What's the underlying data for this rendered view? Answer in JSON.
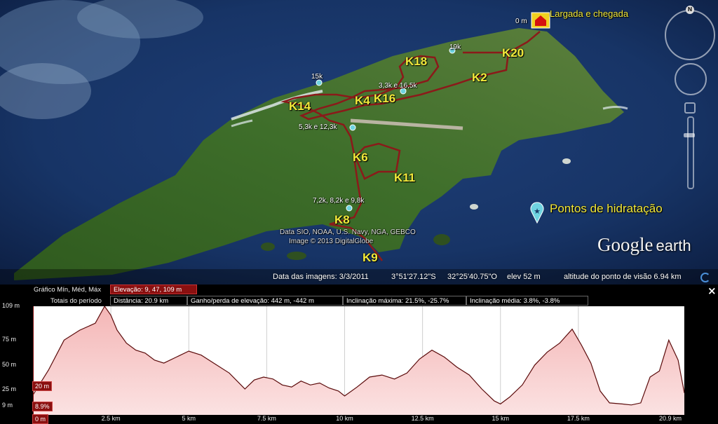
{
  "map": {
    "start_finish_label": "Largada e chegada",
    "start_distance_label": "0 m",
    "hydration_label": "Pontos de hidratação",
    "km_markers": [
      "K18",
      "K20",
      "K2",
      "K4",
      "K16",
      "K14",
      "K6",
      "K11",
      "K8",
      "K9"
    ],
    "hydration_points": [
      "19k",
      "15k",
      "3,3k e 16,5k",
      "5,3k e 12,3k",
      "7,2k, 8,2k e 9,8k"
    ],
    "attribution_line1": "Data SIO, NOAA, U.S. Navy, NGA, GEBCO",
    "attribution_line2": "Image © 2013 DigitalGlobe",
    "brand_google": "Google",
    "brand_earth": "earth",
    "compass_letter": "N",
    "route_color": "#8b1a1a",
    "label_color": "#f2e93a"
  },
  "status_bar": {
    "imagery_date": "Data das imagens: 3/3/2011",
    "latitude": "3°51'27.12\"S",
    "longitude": "32°25'40.75\"O",
    "elevation": "elev   52 m",
    "eye_altitude": "altitude do ponto de visão   6.94 km"
  },
  "panel": {
    "close_label": "×",
    "graph_label": "Gráfico  Mín, Méd, Máx",
    "elevation_stat": "Elevação: 9, 47, 109 m",
    "totals_label": "Totais do período",
    "distance_stat": "Distância: 20.9 km",
    "gain_loss_stat": "Ganho/perda de elevação: 442 m, -442 m",
    "max_slope_stat": "Inclinação máxima: 21.5%, -25.7%",
    "avg_slope_stat": "Inclinação média: 3.8%, -3.8%",
    "cursor_elevation": "20 m",
    "cursor_slope": "8.9%",
    "cursor_distance": "0 m"
  },
  "chart_data": {
    "type": "area",
    "xlabel": "",
    "ylabel": "",
    "x_ticks": [
      "2.5 km",
      "5 km",
      "7.5 km",
      "10 km",
      "12.5 km",
      "15 km",
      "17.5 km",
      "20.9 km"
    ],
    "y_ticks": [
      "109 m",
      "75 m",
      "50 m",
      "25 m",
      "9 m"
    ],
    "x_tick_values": [
      2.5,
      5,
      7.5,
      10,
      12.5,
      15,
      17.5,
      20.9
    ],
    "y_tick_values": [
      109,
      75,
      50,
      25,
      9
    ],
    "xlim": [
      0,
      20.9
    ],
    "ylim": [
      0,
      109
    ],
    "colors": {
      "line": "#5a0a0a",
      "fill": "#f4b6b6",
      "fill_bottom": "#fbe2e2"
    },
    "x": [
      0,
      0.5,
      1.0,
      1.5,
      2.0,
      2.3,
      2.5,
      2.7,
      3.0,
      3.3,
      3.6,
      3.9,
      4.2,
      4.6,
      5.0,
      5.4,
      5.8,
      6.3,
      6.8,
      7.1,
      7.4,
      7.7,
      8.0,
      8.3,
      8.6,
      8.9,
      9.2,
      9.5,
      9.8,
      10.0,
      10.4,
      10.8,
      11.2,
      11.6,
      12.0,
      12.4,
      12.8,
      13.2,
      13.6,
      14.0,
      14.4,
      14.8,
      15.0,
      15.3,
      15.7,
      16.1,
      16.5,
      16.9,
      17.3,
      17.6,
      17.9,
      18.2,
      18.5,
      18.9,
      19.2,
      19.5,
      19.8,
      20.1,
      20.4,
      20.7,
      20.9
    ],
    "y": [
      20,
      45,
      75,
      85,
      92,
      109,
      100,
      85,
      72,
      65,
      62,
      55,
      52,
      58,
      64,
      60,
      52,
      42,
      26,
      35,
      38,
      36,
      30,
      28,
      34,
      30,
      32,
      27,
      24,
      19,
      28,
      38,
      40,
      36,
      42,
      56,
      65,
      58,
      48,
      40,
      26,
      14,
      11,
      18,
      30,
      50,
      63,
      72,
      86,
      70,
      52,
      24,
      12,
      11,
      10,
      12,
      38,
      44,
      75,
      55,
      22
    ]
  }
}
